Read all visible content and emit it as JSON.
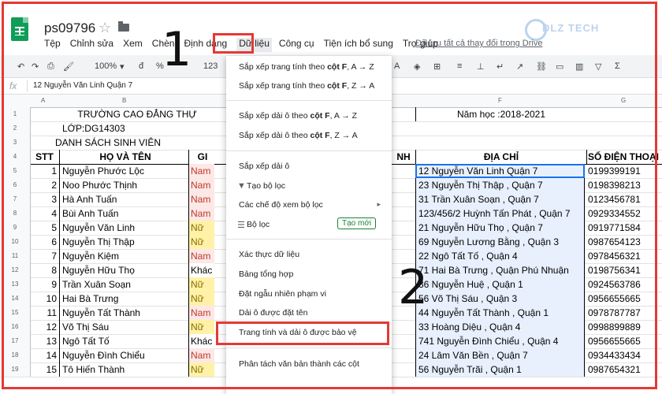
{
  "doc_title": "ps09796",
  "menubar": [
    "Tệp",
    "Chỉnh sửa",
    "Xem",
    "Chèn",
    "Định dạng",
    "Dữ liệu",
    "Công cụ",
    "Tiện ích bổ sung",
    "Trợ giúp"
  ],
  "saved_text": "Đã lưu tất cả thay đổi trong Drive",
  "watermark": "DLZ TECH",
  "toolbar": {
    "zoom": "100%",
    "pct": "%",
    "num": "123"
  },
  "formula": "12 Nguyễn Văn Linh Quận 7",
  "col_headers": {
    "a": "A",
    "b": "B",
    "f": "F",
    "g": "G"
  },
  "row_numbers": [
    "1",
    "2",
    "3",
    "4",
    "5",
    "6",
    "7",
    "8",
    "9",
    "10",
    "11",
    "12",
    "13",
    "14",
    "15",
    "16",
    "17",
    "18",
    "19"
  ],
  "header_rows": {
    "school": "TRƯỜNG CAO ĐẲNG THỰ",
    "class": "LỚP:DG14303",
    "list_title": "DANH SÁCH SINH VIÊN",
    "year": "Năm học :2018-2021",
    "stt": "STT",
    "name": "HỌ VÀ TÊN",
    "gender_partial": "GI",
    "cut_col": "NH",
    "address": "ĐỊA CHỈ",
    "phone": "SỐ ĐIỆN THOẠI"
  },
  "students": [
    {
      "stt": "1",
      "name": "Nguyễn Phước Lộc",
      "gender": "Nam",
      "addr": "12 Nguyễn Văn Linh Quận 7",
      "phone": "0199399191"
    },
    {
      "stt": "2",
      "name": "Noo Phước Thịnh",
      "gender": "Nam",
      "addr": "23 Nguyễn Thị Thập , Quận 7",
      "phone": "0198398213"
    },
    {
      "stt": "3",
      "name": "Hà Anh Tuấn",
      "gender": "Nam",
      "addr": "31 Trần Xuân Soạn , Quận 7",
      "phone": "0123456781"
    },
    {
      "stt": "4",
      "name": "Bùi Anh Tuấn",
      "gender": "Nam",
      "addr": "123/456/2 Huỳnh Tấn Phát , Quận 7",
      "phone": "0929334552"
    },
    {
      "stt": "5",
      "name": "Nguyễn Văn Linh",
      "gender": "Nữ",
      "addr": "21 Nguyễn Hữu Thọ , Quận 7",
      "phone": "0919771584"
    },
    {
      "stt": "6",
      "name": "Nguyễn Thị Thập",
      "gender": "Nữ",
      "addr": "69 Nguyễn Lương Bằng , Quận 3",
      "phone": "0987654123"
    },
    {
      "stt": "7",
      "name": "Nguyễn Kiệm",
      "gender": "Nam",
      "addr": "22 Ngô Tất Tố , Quận 4",
      "phone": "0978456321"
    },
    {
      "stt": "8",
      "name": "Nguyễn Hữu Thọ",
      "gender": "Khác",
      "addr": "71 Hai Bà Trưng , Quận Phú Nhuận",
      "phone": "0198756341"
    },
    {
      "stt": "9",
      "name": "Trần Xuân Soạn",
      "gender": "Nữ",
      "addr": "36 Nguyễn Huệ , Quận 1",
      "phone": "0924563786"
    },
    {
      "stt": "10",
      "name": "Hai Bà Trưng",
      "gender": "Nữ",
      "addr": "56 Võ Thị Sáu , Quận 3",
      "phone": "0956655665"
    },
    {
      "stt": "11",
      "name": "Nguyễn Tất Thành",
      "gender": "Nam",
      "addr": "44 Nguyễn Tất Thành , Quận 1",
      "phone": "0978787787"
    },
    {
      "stt": "12",
      "name": "Võ Thị Sáu",
      "gender": "Nữ",
      "addr": "33 Hoàng Diệu , Quận 4",
      "phone": "0998899889"
    },
    {
      "stt": "13",
      "name": "Ngô Tất Tố",
      "gender": "Khác",
      "addr": "741 Nguyễn Đình Chiểu , Quận 4",
      "phone": "0956655665"
    },
    {
      "stt": "14",
      "name": "Nguyễn Đình Chiểu",
      "gender": "Nam",
      "addr": "24 Lâm Văn Bền , Quận 7",
      "phone": "0934433434"
    },
    {
      "stt": "15",
      "name": "Tô Hiến Thành",
      "gender": "Nữ",
      "addr": "56 Nguyễn Trãi , Quận 1",
      "phone": "0987654321"
    }
  ],
  "data_menu": {
    "sort_sheet_az": [
      "Sắp xếp trang tính theo ",
      "cột F",
      ", A → Z"
    ],
    "sort_sheet_za": [
      "Sắp xếp trang tính theo ",
      "cột F",
      ", Z → A"
    ],
    "sort_range_az": [
      "Sắp xếp dải ô theo ",
      "cột F",
      ", A → Z"
    ],
    "sort_range_za": [
      "Sắp xếp dải ô theo ",
      "cột F",
      ", Z → A"
    ],
    "sort_range": "Sắp xếp dải ô",
    "create_filter": "Tạo bộ lọc",
    "filter_views": "Các chế độ xem bộ lọc",
    "slicer": "Bộ lọc",
    "new_badge": "Tạo mới",
    "validation": "Xác thực dữ liệu",
    "pivot": "Bảng tổng hợp",
    "randomize": "Đặt ngẫu nhiên phạm vi",
    "named_ranges": "Dải ô được đặt tên",
    "protected": "Trang tính và dải ô được bảo vệ",
    "split_text": "Phân tách văn bản thành các cột"
  },
  "annotations": {
    "step1": "1",
    "step2": "2"
  },
  "colors": {
    "highlight": "#e53935",
    "sheets_green": "#0f9d58",
    "selected_addr": "#e8f0fe"
  }
}
